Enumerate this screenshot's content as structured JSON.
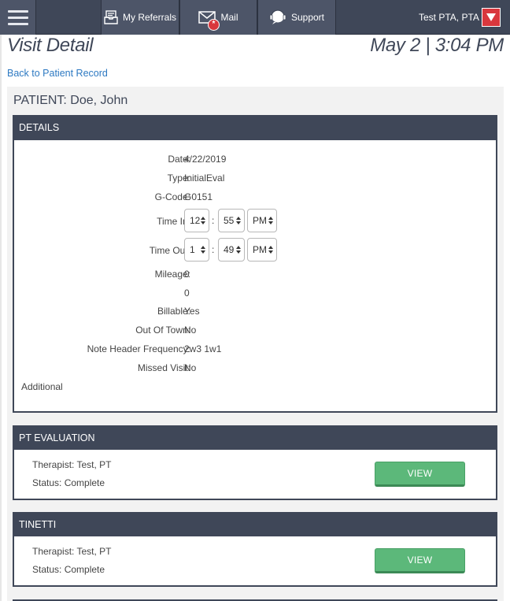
{
  "nav": {
    "my_referrals": "My Referrals",
    "mail": "Mail",
    "mail_badge": "*",
    "support": "Support",
    "user": "Test PTA, PTA"
  },
  "page": {
    "title": "Visit Detail",
    "datetime": "May 2 | 3:04 PM",
    "back_link": "Back to Patient Record"
  },
  "patient": {
    "header": "PATIENT: Doe, John"
  },
  "details": {
    "heading": "DETAILS",
    "date_label": "Date:",
    "date": "4/22/2019",
    "type_label": "Type:",
    "type": "InitialEval",
    "gcode_label": "G-Code:",
    "gcode": "G0151",
    "time_in_label": "Time In:",
    "time_in": {
      "hour": "12",
      "minute": "55",
      "ampm": "PM"
    },
    "time_out_label": "Time Out:",
    "time_out": {
      "hour": "1",
      "minute": "49",
      "ampm": "PM"
    },
    "time_separator": ":",
    "mileage_label": "Mileage:",
    "mileage": "0",
    "mileage_extra": "0",
    "billable_label": "Billable:",
    "billable": "Yes",
    "out_of_town_label": "Out Of Town:",
    "out_of_town": "No",
    "frequency_label": "Note Header Frequency:",
    "frequency": "2w3 1w1",
    "missed_visit_label": "Missed Visit:",
    "missed_visit": "No",
    "additional_label": "Additional"
  },
  "sections": [
    {
      "heading": "PT EVALUATION",
      "therapist": "Therapist: Test, PT",
      "status": "Status: Complete",
      "button": "VIEW"
    },
    {
      "heading": "TINETTI",
      "therapist": "Therapist: Test, PT",
      "status": "Status: Complete",
      "button": "VIEW"
    }
  ],
  "colors": {
    "nav_bg": "#3f4758",
    "accent_red": "#d9373d",
    "link_blue": "#2d79c2",
    "view_green": "#5cb87a"
  }
}
